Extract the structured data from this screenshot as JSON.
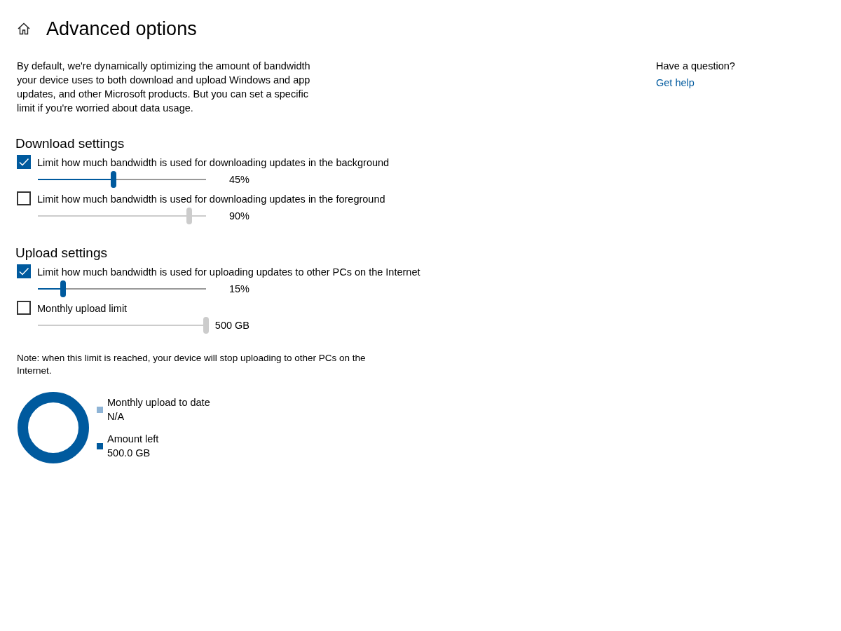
{
  "header": {
    "title": "Advanced options"
  },
  "description": "By default, we're dynamically optimizing the amount of bandwidth your device uses to both download and upload Windows and app updates, and other Microsoft products. But you can set a specific limit if you're worried about data usage.",
  "sections": [
    {
      "heading": "Download settings",
      "settings": [
        {
          "label": "Limit how much bandwidth is used for downloading updates in the background",
          "checked": true,
          "level": 0.45,
          "reading": "45%"
        },
        {
          "label": "Limit how much bandwidth is used for downloading updates in the foreground",
          "checked": false,
          "level": 0.9,
          "reading": "90%"
        }
      ]
    },
    {
      "heading": "Upload settings",
      "settings": [
        {
          "label": "Limit how much bandwidth is used for uploading updates to other PCs on the Internet",
          "checked": true,
          "level": 0.15,
          "reading": "15%"
        },
        {
          "label": "Monthly upload limit",
          "checked": false,
          "level": 1,
          "reading": "500 GB"
        }
      ]
    }
  ],
  "note": "Note: when this limit is reached, your device will stop uploading to other PCs on the Internet.",
  "usage_legend": [
    {
      "label": "Monthly upload to date",
      "value": "N/A",
      "color": "#8fb4d6"
    },
    {
      "label": "Amount left",
      "value": "500.0 GB",
      "color": "#005a9e"
    }
  ],
  "help": {
    "question": "Have a question?",
    "link": "Get help"
  }
}
